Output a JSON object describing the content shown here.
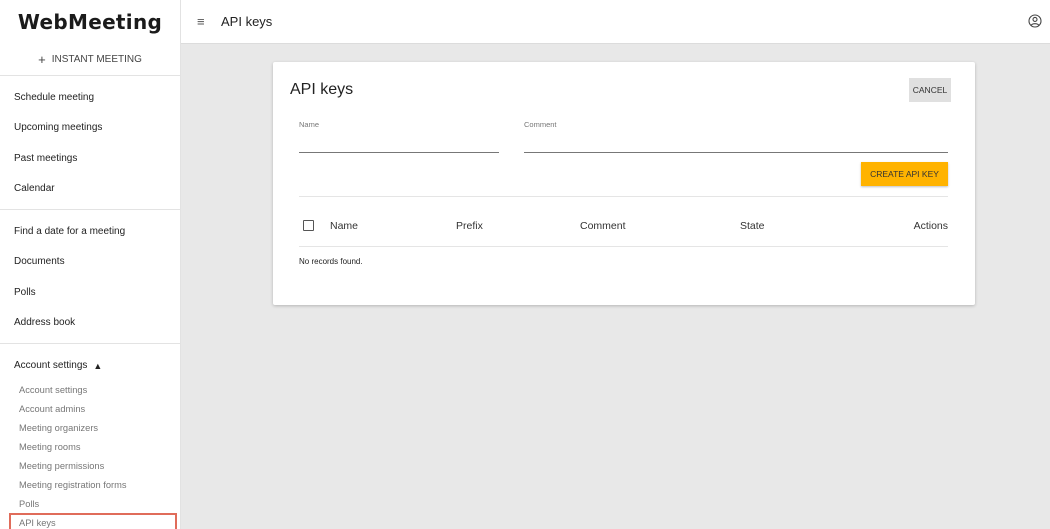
{
  "app": {
    "brand": "WebMeeting"
  },
  "sidebar": {
    "instant_meeting": "INSTANT MEETING",
    "group1": [
      {
        "label": "Schedule meeting"
      },
      {
        "label": "Upcoming meetings"
      },
      {
        "label": "Past meetings"
      },
      {
        "label": "Calendar"
      }
    ],
    "group2": [
      {
        "label": "Find a date for a meeting"
      },
      {
        "label": "Documents"
      },
      {
        "label": "Polls"
      },
      {
        "label": "Address book"
      }
    ],
    "account_section": {
      "label": "Account settings",
      "expanded": true,
      "items": [
        {
          "label": "Account settings"
        },
        {
          "label": "Account admins"
        },
        {
          "label": "Meeting organizers"
        },
        {
          "label": "Meeting rooms"
        },
        {
          "label": "Meeting permissions"
        },
        {
          "label": "Meeting registration forms"
        },
        {
          "label": "Polls"
        },
        {
          "label": "API keys",
          "active": true
        }
      ]
    }
  },
  "header": {
    "title": "API keys",
    "menu_icon": "menu-icon",
    "user_icon": "account-circle-icon"
  },
  "card": {
    "title": "API keys",
    "cancel_label": "CANCEL",
    "name_field": {
      "label": "Name",
      "value": ""
    },
    "comment_field": {
      "label": "Comment",
      "value": ""
    },
    "create_label": "CREATE API KEY",
    "columns": [
      "Name",
      "Prefix",
      "Comment",
      "State",
      "Actions"
    ],
    "empty_text": "No records found."
  },
  "colors": {
    "accent": "#ffb300",
    "active_outline": "#e06c5a"
  }
}
